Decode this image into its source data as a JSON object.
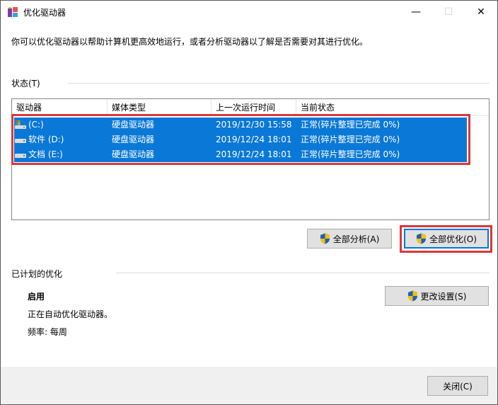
{
  "window": {
    "title": "优化驱动器"
  },
  "intro": "你可以优化驱动器以帮助计算机更高效地运行，或者分析驱动器以了解是否需要对其进行优化。",
  "status_group": "状态(T)",
  "columns": [
    "驱动器",
    "媒体类型",
    "上一次运行时间",
    "当前状态"
  ],
  "drives": [
    {
      "name": "(C:)",
      "media": "硬盘驱动器",
      "last_run": "2019/12/30 15:58",
      "status": "正常(碎片整理已完成 0%)"
    },
    {
      "name": "软件 (D:)",
      "media": "硬盘驱动器",
      "last_run": "2019/12/24 18:01",
      "status": "正常(碎片整理已完成 0%)"
    },
    {
      "name": "文档 (E:)",
      "media": "硬盘驱动器",
      "last_run": "2019/12/24 18:01",
      "status": "正常(碎片整理已完成 0%)"
    }
  ],
  "buttons": {
    "analyze_all": "全部分析(A)",
    "optimize_all": "全部优化(O)",
    "change_settings": "更改设置(S)",
    "close": "关闭(C)"
  },
  "schedule": {
    "group": "已计划的优化",
    "state": "启用",
    "description": "正在自动优化驱动器。",
    "frequency": "频率: 每周"
  },
  "colors": {
    "selection": "#0a78d7",
    "highlight_box": "#d9383a",
    "shield_blue": "#1f5fb8",
    "shield_yellow": "#f2c200"
  }
}
